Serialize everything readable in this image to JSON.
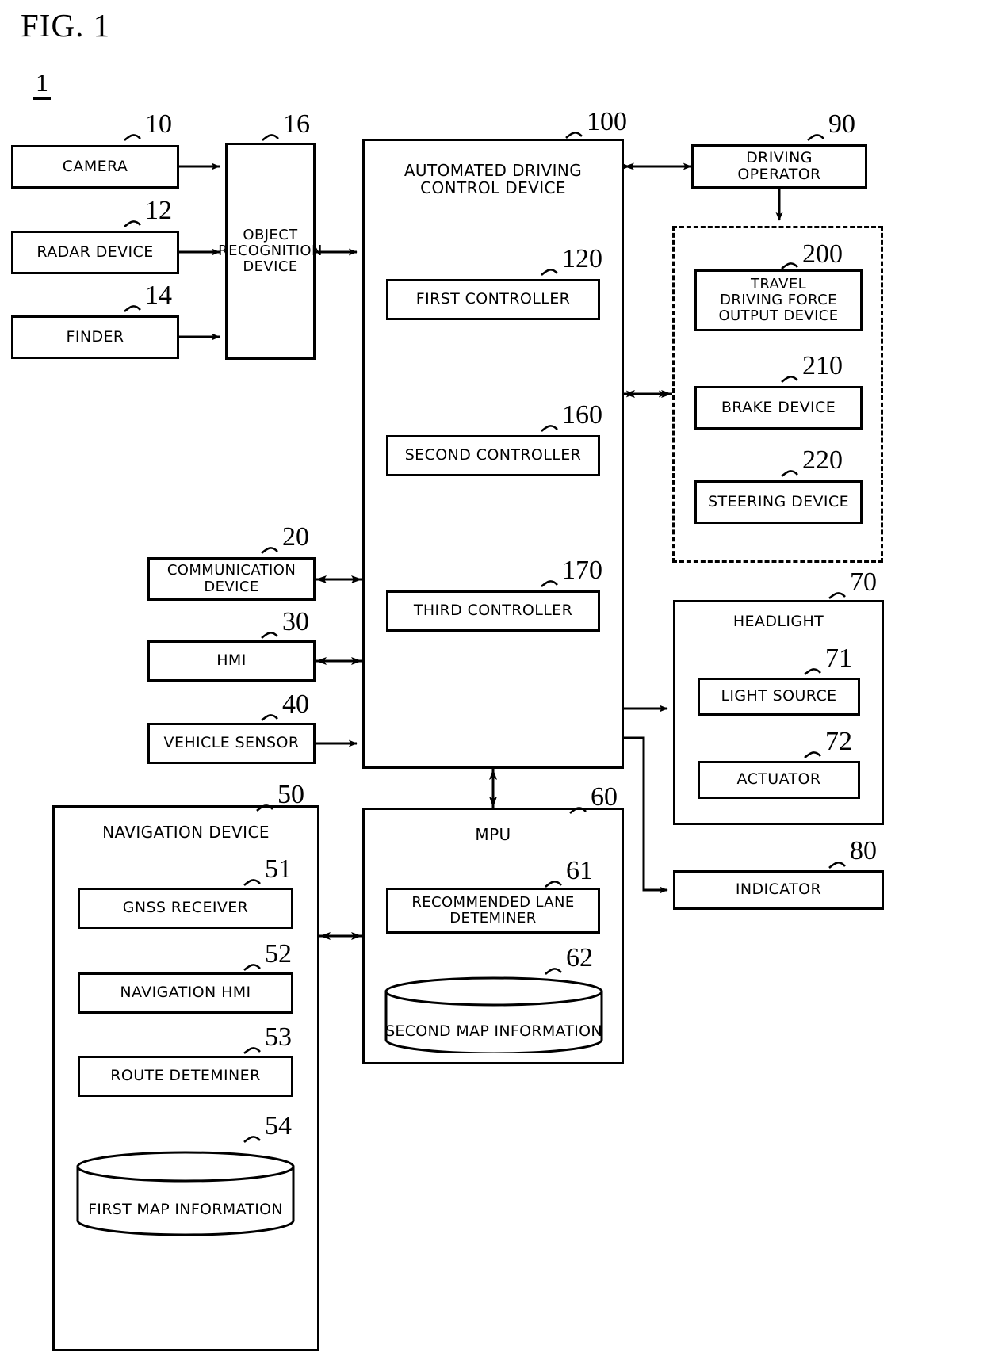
{
  "figure": {
    "title": "FIG. 1",
    "system_number": "1"
  },
  "blocks": {
    "camera": {
      "label": "CAMERA",
      "ref": "10"
    },
    "radar": {
      "label": "RADAR DEVICE",
      "ref": "12"
    },
    "finder": {
      "label": "FINDER",
      "ref": "14"
    },
    "object_recognition": {
      "label": "OBJECT\nRECOGNITION\nDEVICE",
      "ref": "16"
    },
    "communication": {
      "label": "COMMUNICATION\nDEVICE",
      "ref": "20"
    },
    "hmi": {
      "label": "HMI",
      "ref": "30"
    },
    "vehicle_sensor": {
      "label": "VEHICLE SENSOR",
      "ref": "40"
    },
    "automated_driving": {
      "label": "AUTOMATED DRIVING\nCONTROL DEVICE",
      "ref": "100"
    },
    "first_controller": {
      "label": "FIRST CONTROLLER",
      "ref": "120"
    },
    "second_controller": {
      "label": "SECOND CONTROLLER",
      "ref": "160"
    },
    "third_controller": {
      "label": "THIRD CONTROLLER",
      "ref": "170"
    },
    "driving_operator": {
      "label": "DRIVING\nOPERATOR",
      "ref": "90"
    },
    "travel_driving": {
      "label": "TRAVEL\nDRIVING FORCE\nOUTPUT DEVICE",
      "ref": "200"
    },
    "brake": {
      "label": "BRAKE DEVICE",
      "ref": "210"
    },
    "steering": {
      "label": "STEERING DEVICE",
      "ref": "220"
    },
    "headlight": {
      "label": "HEADLIGHT",
      "ref": "70"
    },
    "light_source": {
      "label": "LIGHT SOURCE",
      "ref": "71"
    },
    "actuator": {
      "label": "ACTUATOR",
      "ref": "72"
    },
    "indicator": {
      "label": "INDICATOR",
      "ref": "80"
    },
    "navigation": {
      "label": "NAVIGATION DEVICE",
      "ref": "50"
    },
    "gnss": {
      "label": "GNSS RECEIVER",
      "ref": "51"
    },
    "nav_hmi": {
      "label": "NAVIGATION HMI",
      "ref": "52"
    },
    "route_determiner": {
      "label": "ROUTE DETEMINER",
      "ref": "53"
    },
    "first_map": {
      "label": "FIRST MAP INFORMATION",
      "ref": "54"
    },
    "mpu": {
      "label": "MPU",
      "ref": "60"
    },
    "recommended_lane": {
      "label": "RECOMMENDED LANE\nDETEMINER",
      "ref": "61"
    },
    "second_map": {
      "label": "SECOND MAP INFORMATION",
      "ref": "62"
    }
  },
  "colors": {
    "stroke": "#000000",
    "background": "#ffffff"
  }
}
